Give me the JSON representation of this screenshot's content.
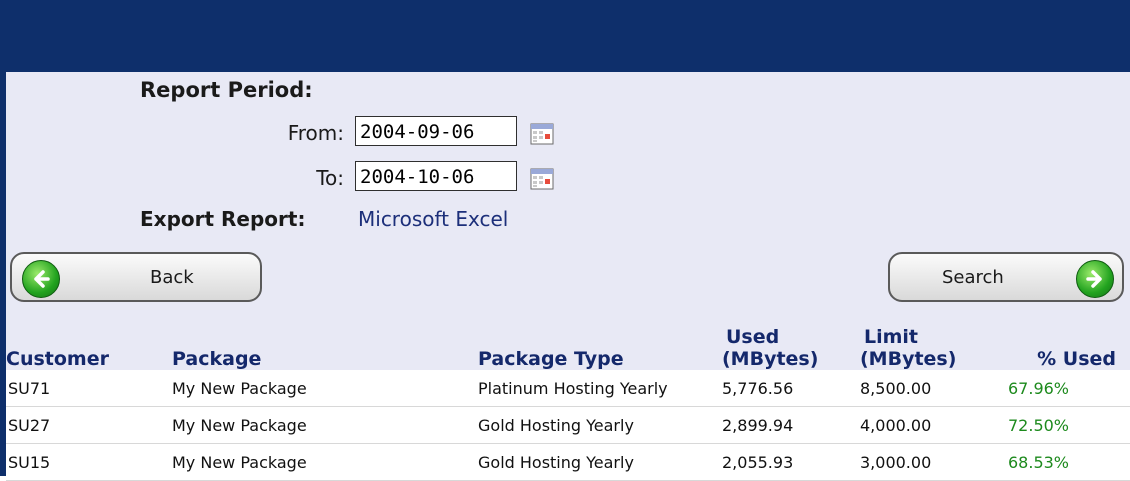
{
  "report": {
    "title": "Report Period:",
    "from_label": "From:",
    "from_value": "2004-09-06",
    "to_label": "To:",
    "to_value": "2004-10-06",
    "export_label": "Export Report:",
    "export_link": "Microsoft Excel"
  },
  "buttons": {
    "back": "Back",
    "search": "Search"
  },
  "table": {
    "headers": {
      "customer": "Customer",
      "package": "Package",
      "package_type": "Package Type",
      "used_line1": "Used",
      "used_line2": "(MBytes)",
      "limit_line1": "Limit",
      "limit_line2": "(MBytes)",
      "pct_used": "% Used"
    },
    "rows": [
      {
        "customer": "SU71",
        "package": "My New Package",
        "package_type": "Platinum Hosting Yearly",
        "used": "5,776.56",
        "limit": "8,500.00",
        "pct": "67.96%"
      },
      {
        "customer": "SU27",
        "package": "My New Package",
        "package_type": "Gold Hosting Yearly",
        "used": "2,899.94",
        "limit": "4,000.00",
        "pct": "72.50%"
      },
      {
        "customer": "SU15",
        "package": "My New Package",
        "package_type": "Gold Hosting Yearly",
        "used": "2,055.93",
        "limit": "3,000.00",
        "pct": "68.53%"
      }
    ]
  },
  "colors": {
    "header_bar": "#0e2f6b",
    "background": "#e8e9f5",
    "link": "#1c2f7a",
    "percent": "#1d8a1d"
  }
}
